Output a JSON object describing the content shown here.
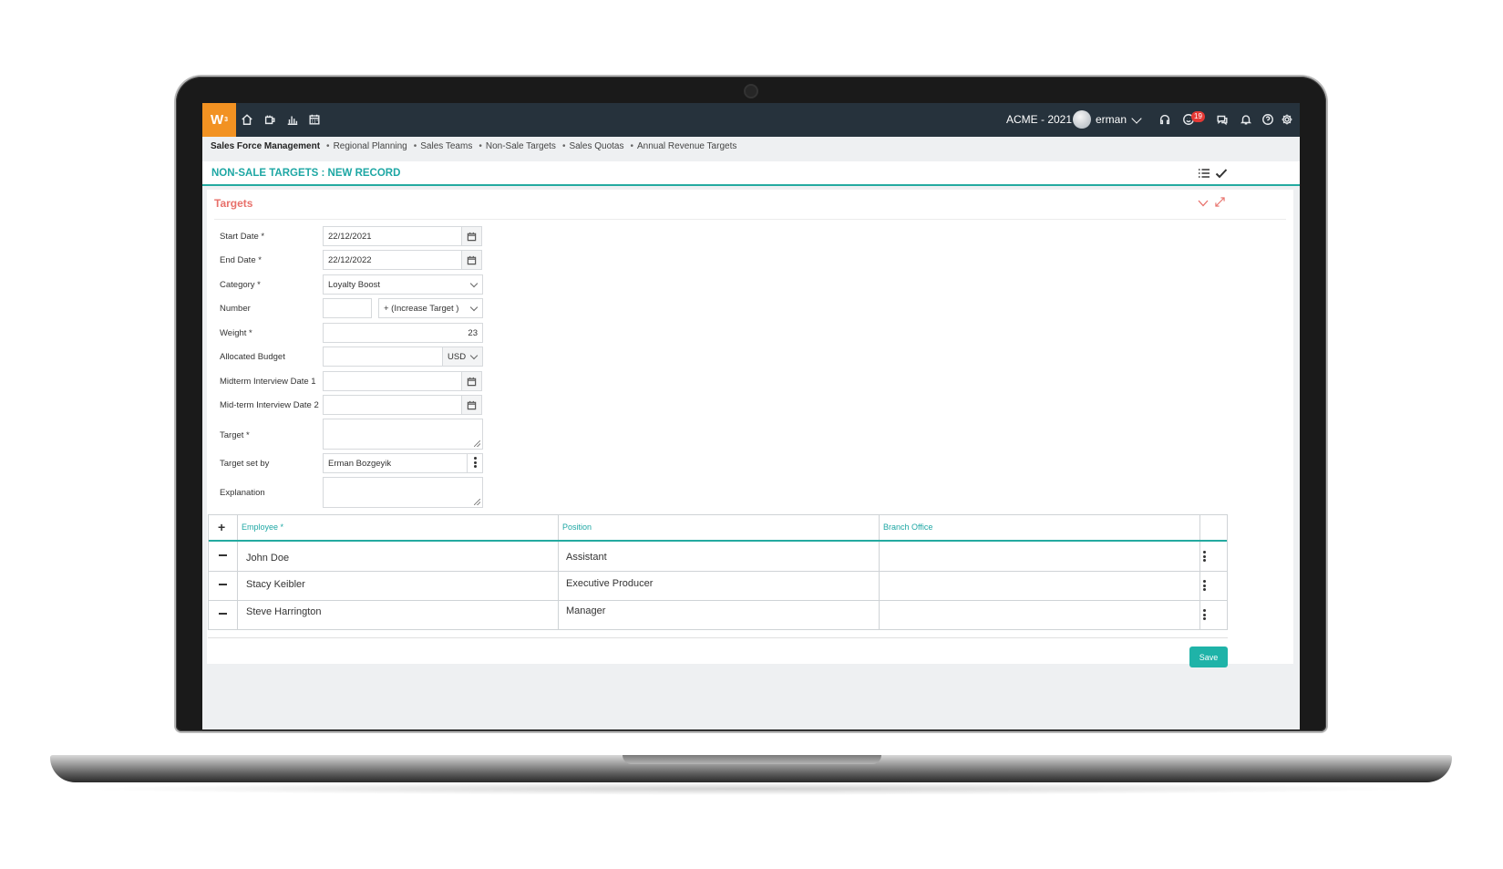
{
  "topbar": {
    "logo": "W",
    "logo_sup": "3",
    "nav_icons": [
      "home-icon",
      "box-icon",
      "chart-icon",
      "calendar-icon"
    ],
    "company": "ACME - 2021",
    "user": "erman",
    "notification_count": "19",
    "right_icons": [
      "headset-icon",
      "smile-icon",
      "chat-icon",
      "bell-icon",
      "help-icon",
      "gear-icon"
    ]
  },
  "breadcrumb": {
    "first": "Sales Force Management",
    "items": [
      "Regional Planning",
      "Sales Teams",
      "Non-Sale Targets",
      "Sales Quotas",
      "Annual Revenue Targets"
    ]
  },
  "page": {
    "title": "NON-SALE TARGETS : NEW RECORD"
  },
  "panel": {
    "title": "Targets"
  },
  "form": {
    "start_date_label": "Start Date *",
    "start_date_value": "22/12/2021",
    "end_date_label": "End Date *",
    "end_date_value": "22/12/2022",
    "category_label": "Category *",
    "category_value": "Loyalty Boost",
    "number_label": "Number",
    "number_value": "",
    "number_mode": "+ (Increase Target )",
    "weight_label": "Weight *",
    "weight_value": "23",
    "budget_label": "Allocated Budget",
    "budget_value": "",
    "budget_currency": "USD",
    "midterm1_label": "Midterm Interview Date 1",
    "midterm1_value": "",
    "midterm2_label": "Mid-term Interview Date 2",
    "midterm2_value": "",
    "target_label": "Target *",
    "target_value": "",
    "target_set_by_label": "Target set by",
    "target_set_by_value": "Erman Bozgeyik",
    "explanation_label": "Explanation",
    "explanation_value": ""
  },
  "table": {
    "columns": [
      "Employee *",
      "Position",
      "Branch Office"
    ],
    "rows": [
      {
        "employee": "John Doe",
        "position": "Assistant",
        "branch": ""
      },
      {
        "employee": "Stacy Keibler",
        "position": "Executive Producer",
        "branch": ""
      },
      {
        "employee": "Steve Harrington",
        "position": "Manager",
        "branch": ""
      }
    ]
  },
  "actions": {
    "save_label": "Save"
  },
  "colors": {
    "topbar": "#26323c",
    "logo": "#f29222",
    "accent": "#1ea7a4",
    "panel_title": "#e8706a",
    "badge": "#e53935"
  }
}
